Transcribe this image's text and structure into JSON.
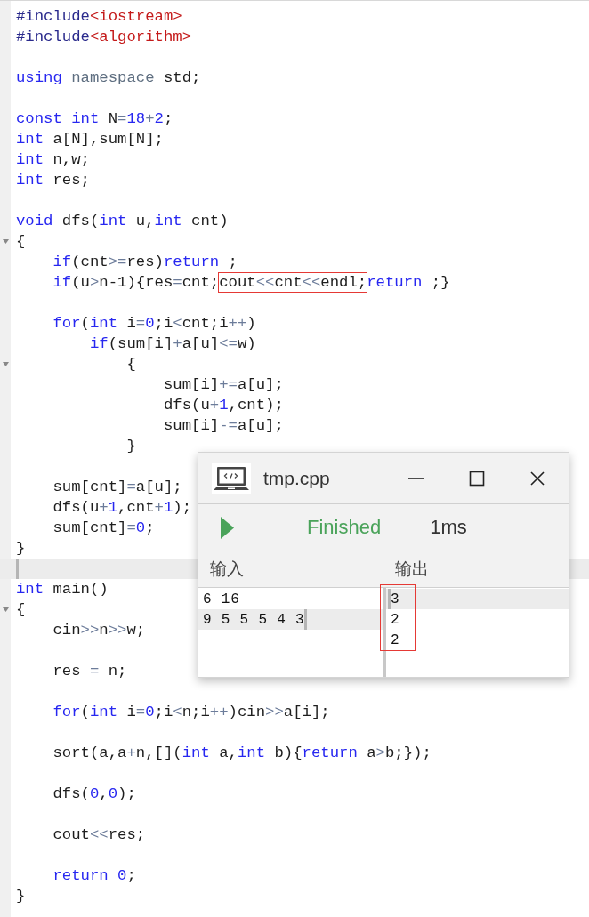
{
  "editor": {
    "lines": [
      {
        "fold": false,
        "current": false,
        "tokens": [
          {
            "text": "#include",
            "kind": "pre"
          },
          {
            "text": "<iostream>",
            "kind": "str"
          }
        ]
      },
      {
        "fold": false,
        "current": false,
        "tokens": [
          {
            "text": "#include",
            "kind": "pre"
          },
          {
            "text": "<algorithm>",
            "kind": "str"
          }
        ]
      },
      {
        "fold": false,
        "current": false
      },
      {
        "fold": false,
        "current": false,
        "tokens": [
          {
            "text": "using",
            "kind": "kw"
          },
          {
            "text": " namespace",
            "kind": "ns"
          },
          {
            "text": " std;",
            "kind": "id"
          }
        ]
      },
      {
        "fold": false,
        "current": false
      },
      {
        "fold": false,
        "current": false,
        "tokens": [
          {
            "text": "const",
            "kind": "kw"
          },
          {
            "text": " int",
            "kind": "kw"
          },
          {
            "text": " N",
            "kind": "id"
          },
          {
            "text": "=",
            "kind": "op"
          },
          {
            "text": "18",
            "kind": "num"
          },
          {
            "text": "+",
            "kind": "op"
          },
          {
            "text": "2",
            "kind": "num"
          },
          {
            "text": ";",
            "kind": "id"
          }
        ]
      },
      {
        "fold": false,
        "current": false,
        "tokens": [
          {
            "text": "int",
            "kind": "kw"
          },
          {
            "text": " a[N],sum[N];",
            "kind": "id"
          }
        ]
      },
      {
        "fold": false,
        "current": false,
        "tokens": [
          {
            "text": "int",
            "kind": "kw"
          },
          {
            "text": " n,w;",
            "kind": "id"
          }
        ]
      },
      {
        "fold": false,
        "current": false,
        "tokens": [
          {
            "text": "int",
            "kind": "kw"
          },
          {
            "text": " res;",
            "kind": "id"
          }
        ]
      },
      {
        "fold": false,
        "current": false
      },
      {
        "fold": false,
        "current": false,
        "tokens": [
          {
            "text": "void",
            "kind": "kw"
          },
          {
            "text": " dfs(",
            "kind": "id"
          },
          {
            "text": "int",
            "kind": "kw"
          },
          {
            "text": " u,",
            "kind": "id"
          },
          {
            "text": "int",
            "kind": "kw"
          },
          {
            "text": " cnt)",
            "kind": "id"
          }
        ]
      },
      {
        "fold": true,
        "current": false,
        "tokens": [
          {
            "text": "{",
            "kind": "id"
          }
        ]
      },
      {
        "fold": false,
        "current": false,
        "tokens": [
          {
            "text": "    if",
            "kind": "kw"
          },
          {
            "text": "(cnt",
            "kind": "id"
          },
          {
            "text": ">=",
            "kind": "op"
          },
          {
            "text": "res)",
            "kind": "id"
          },
          {
            "text": "return",
            "kind": "kw"
          },
          {
            "text": " ;",
            "kind": "id"
          }
        ]
      },
      {
        "fold": false,
        "current": false,
        "tokens": [
          {
            "text": "    if",
            "kind": "kw"
          },
          {
            "text": "(u",
            "kind": "id"
          },
          {
            "text": ">",
            "kind": "op"
          },
          {
            "text": "n-1){res",
            "kind": "id"
          },
          {
            "text": "=",
            "kind": "op"
          },
          {
            "text": "cnt;",
            "kind": "id"
          },
          {
            "kind": "group",
            "outlined": true,
            "tokens": [
              {
                "text": "cout",
                "kind": "id"
              },
              {
                "text": "<<",
                "kind": "op"
              },
              {
                "text": "cnt",
                "kind": "id"
              },
              {
                "text": "<<",
                "kind": "op"
              },
              {
                "text": "endl;",
                "kind": "id"
              }
            ]
          },
          {
            "text": "return",
            "kind": "kw"
          },
          {
            "text": " ;}",
            "kind": "id"
          }
        ]
      },
      {
        "fold": false,
        "current": false
      },
      {
        "fold": false,
        "current": false,
        "tokens": [
          {
            "text": "    for",
            "kind": "kw"
          },
          {
            "text": "(",
            "kind": "id"
          },
          {
            "text": "int",
            "kind": "kw"
          },
          {
            "text": " i",
            "kind": "id"
          },
          {
            "text": "=",
            "kind": "op"
          },
          {
            "text": "0",
            "kind": "num"
          },
          {
            "text": ";i",
            "kind": "id"
          },
          {
            "text": "<",
            "kind": "op"
          },
          {
            "text": "cnt;i",
            "kind": "id"
          },
          {
            "text": "++",
            "kind": "op"
          },
          {
            "text": ")",
            "kind": "id"
          }
        ]
      },
      {
        "fold": false,
        "current": false,
        "tokens": [
          {
            "text": "        if",
            "kind": "kw"
          },
          {
            "text": "(sum[i]",
            "kind": "id"
          },
          {
            "text": "+",
            "kind": "op"
          },
          {
            "text": "a[u]",
            "kind": "id"
          },
          {
            "text": "<=",
            "kind": "op"
          },
          {
            "text": "w)",
            "kind": "id"
          }
        ]
      },
      {
        "fold": true,
        "current": false,
        "tokens": [
          {
            "text": "            {",
            "kind": "id"
          }
        ]
      },
      {
        "fold": false,
        "current": false,
        "tokens": [
          {
            "text": "                sum[i]",
            "kind": "id"
          },
          {
            "text": "+=",
            "kind": "op"
          },
          {
            "text": "a[u];",
            "kind": "id"
          }
        ]
      },
      {
        "fold": false,
        "current": false,
        "tokens": [
          {
            "text": "                dfs(u",
            "kind": "id"
          },
          {
            "text": "+",
            "kind": "op"
          },
          {
            "text": "1",
            "kind": "num"
          },
          {
            "text": ",cnt);",
            "kind": "id"
          }
        ]
      },
      {
        "fold": false,
        "current": false,
        "tokens": [
          {
            "text": "                sum[i]",
            "kind": "id"
          },
          {
            "text": "-=",
            "kind": "op"
          },
          {
            "text": "a[u];",
            "kind": "id"
          }
        ]
      },
      {
        "fold": false,
        "current": false,
        "tokens": [
          {
            "text": "            }",
            "kind": "id"
          }
        ]
      },
      {
        "fold": false,
        "current": false
      },
      {
        "fold": false,
        "current": false,
        "tokens": [
          {
            "text": "    sum[cnt]",
            "kind": "id"
          },
          {
            "text": "=",
            "kind": "op"
          },
          {
            "text": "a[u];",
            "kind": "id"
          }
        ]
      },
      {
        "fold": false,
        "current": false,
        "tokens": [
          {
            "text": "    dfs(u",
            "kind": "id"
          },
          {
            "text": "+",
            "kind": "op"
          },
          {
            "text": "1",
            "kind": "num"
          },
          {
            "text": ",cnt",
            "kind": "id"
          },
          {
            "text": "+",
            "kind": "op"
          },
          {
            "text": "1",
            "kind": "num"
          },
          {
            "text": ");",
            "kind": "id"
          }
        ]
      },
      {
        "fold": false,
        "current": false,
        "tokens": [
          {
            "text": "    sum[cnt]",
            "kind": "id"
          },
          {
            "text": "=",
            "kind": "op"
          },
          {
            "text": "0",
            "kind": "num"
          },
          {
            "text": ";",
            "kind": "id"
          }
        ]
      },
      {
        "fold": false,
        "current": false,
        "tokens": [
          {
            "text": "}",
            "kind": "id"
          }
        ]
      },
      {
        "fold": false,
        "current": true
      },
      {
        "fold": false,
        "current": false,
        "tokens": [
          {
            "text": "int",
            "kind": "kw"
          },
          {
            "text": " main()",
            "kind": "id"
          }
        ]
      },
      {
        "fold": true,
        "current": false,
        "tokens": [
          {
            "text": "{",
            "kind": "id"
          }
        ]
      },
      {
        "fold": false,
        "current": false,
        "tokens": [
          {
            "text": "    cin",
            "kind": "id"
          },
          {
            "text": ">>",
            "kind": "op"
          },
          {
            "text": "n",
            "kind": "id"
          },
          {
            "text": ">>",
            "kind": "op"
          },
          {
            "text": "w;",
            "kind": "id"
          }
        ]
      },
      {
        "fold": false,
        "current": false
      },
      {
        "fold": false,
        "current": false,
        "tokens": [
          {
            "text": "    res ",
            "kind": "id"
          },
          {
            "text": "=",
            "kind": "op"
          },
          {
            "text": " n;",
            "kind": "id"
          }
        ]
      },
      {
        "fold": false,
        "current": false
      },
      {
        "fold": false,
        "current": false,
        "tokens": [
          {
            "text": "    for",
            "kind": "kw"
          },
          {
            "text": "(",
            "kind": "id"
          },
          {
            "text": "int",
            "kind": "kw"
          },
          {
            "text": " i",
            "kind": "id"
          },
          {
            "text": "=",
            "kind": "op"
          },
          {
            "text": "0",
            "kind": "num"
          },
          {
            "text": ";i",
            "kind": "id"
          },
          {
            "text": "<",
            "kind": "op"
          },
          {
            "text": "n;i",
            "kind": "id"
          },
          {
            "text": "++",
            "kind": "op"
          },
          {
            "text": ")cin",
            "kind": "id"
          },
          {
            "text": ">>",
            "kind": "op"
          },
          {
            "text": "a[i];",
            "kind": "id"
          }
        ]
      },
      {
        "fold": false,
        "current": false
      },
      {
        "fold": false,
        "current": false,
        "tokens": [
          {
            "text": "    sort(a,a",
            "kind": "id"
          },
          {
            "text": "+",
            "kind": "op"
          },
          {
            "text": "n,[](",
            "kind": "id"
          },
          {
            "text": "int",
            "kind": "kw"
          },
          {
            "text": " a,",
            "kind": "id"
          },
          {
            "text": "int",
            "kind": "kw"
          },
          {
            "text": " b){",
            "kind": "id"
          },
          {
            "text": "return",
            "kind": "kw"
          },
          {
            "text": " a",
            "kind": "id"
          },
          {
            "text": ">",
            "kind": "op"
          },
          {
            "text": "b;});",
            "kind": "id"
          }
        ]
      },
      {
        "fold": false,
        "current": false
      },
      {
        "fold": false,
        "current": false,
        "tokens": [
          {
            "text": "    dfs(",
            "kind": "id"
          },
          {
            "text": "0",
            "kind": "num"
          },
          {
            "text": ",",
            "kind": "id"
          },
          {
            "text": "0",
            "kind": "num"
          },
          {
            "text": ");",
            "kind": "id"
          }
        ]
      },
      {
        "fold": false,
        "current": false
      },
      {
        "fold": false,
        "current": false,
        "tokens": [
          {
            "text": "    cout",
            "kind": "id"
          },
          {
            "text": "<<",
            "kind": "op"
          },
          {
            "text": "res;",
            "kind": "id"
          }
        ]
      },
      {
        "fold": false,
        "current": false
      },
      {
        "fold": false,
        "current": false,
        "tokens": [
          {
            "text": "    return",
            "kind": "kw"
          },
          {
            "text": " 0",
            "kind": "num"
          },
          {
            "text": ";",
            "kind": "id"
          }
        ]
      },
      {
        "fold": false,
        "current": false,
        "tokens": [
          {
            "text": "}",
            "kind": "id"
          }
        ]
      }
    ]
  },
  "run_window": {
    "title": "tmp.cpp",
    "status": "Finished",
    "time": "1ms",
    "input": {
      "header": "输入",
      "lines": [
        {
          "text": "6 16",
          "current": false
        },
        {
          "text": "9 5 5 5 4 3",
          "current": true
        }
      ]
    },
    "output": {
      "header": "输出",
      "outlined": true,
      "lines": [
        {
          "text": "3",
          "current": true
        },
        {
          "text": "2",
          "current": false
        },
        {
          "text": "2",
          "current": false
        }
      ]
    }
  }
}
